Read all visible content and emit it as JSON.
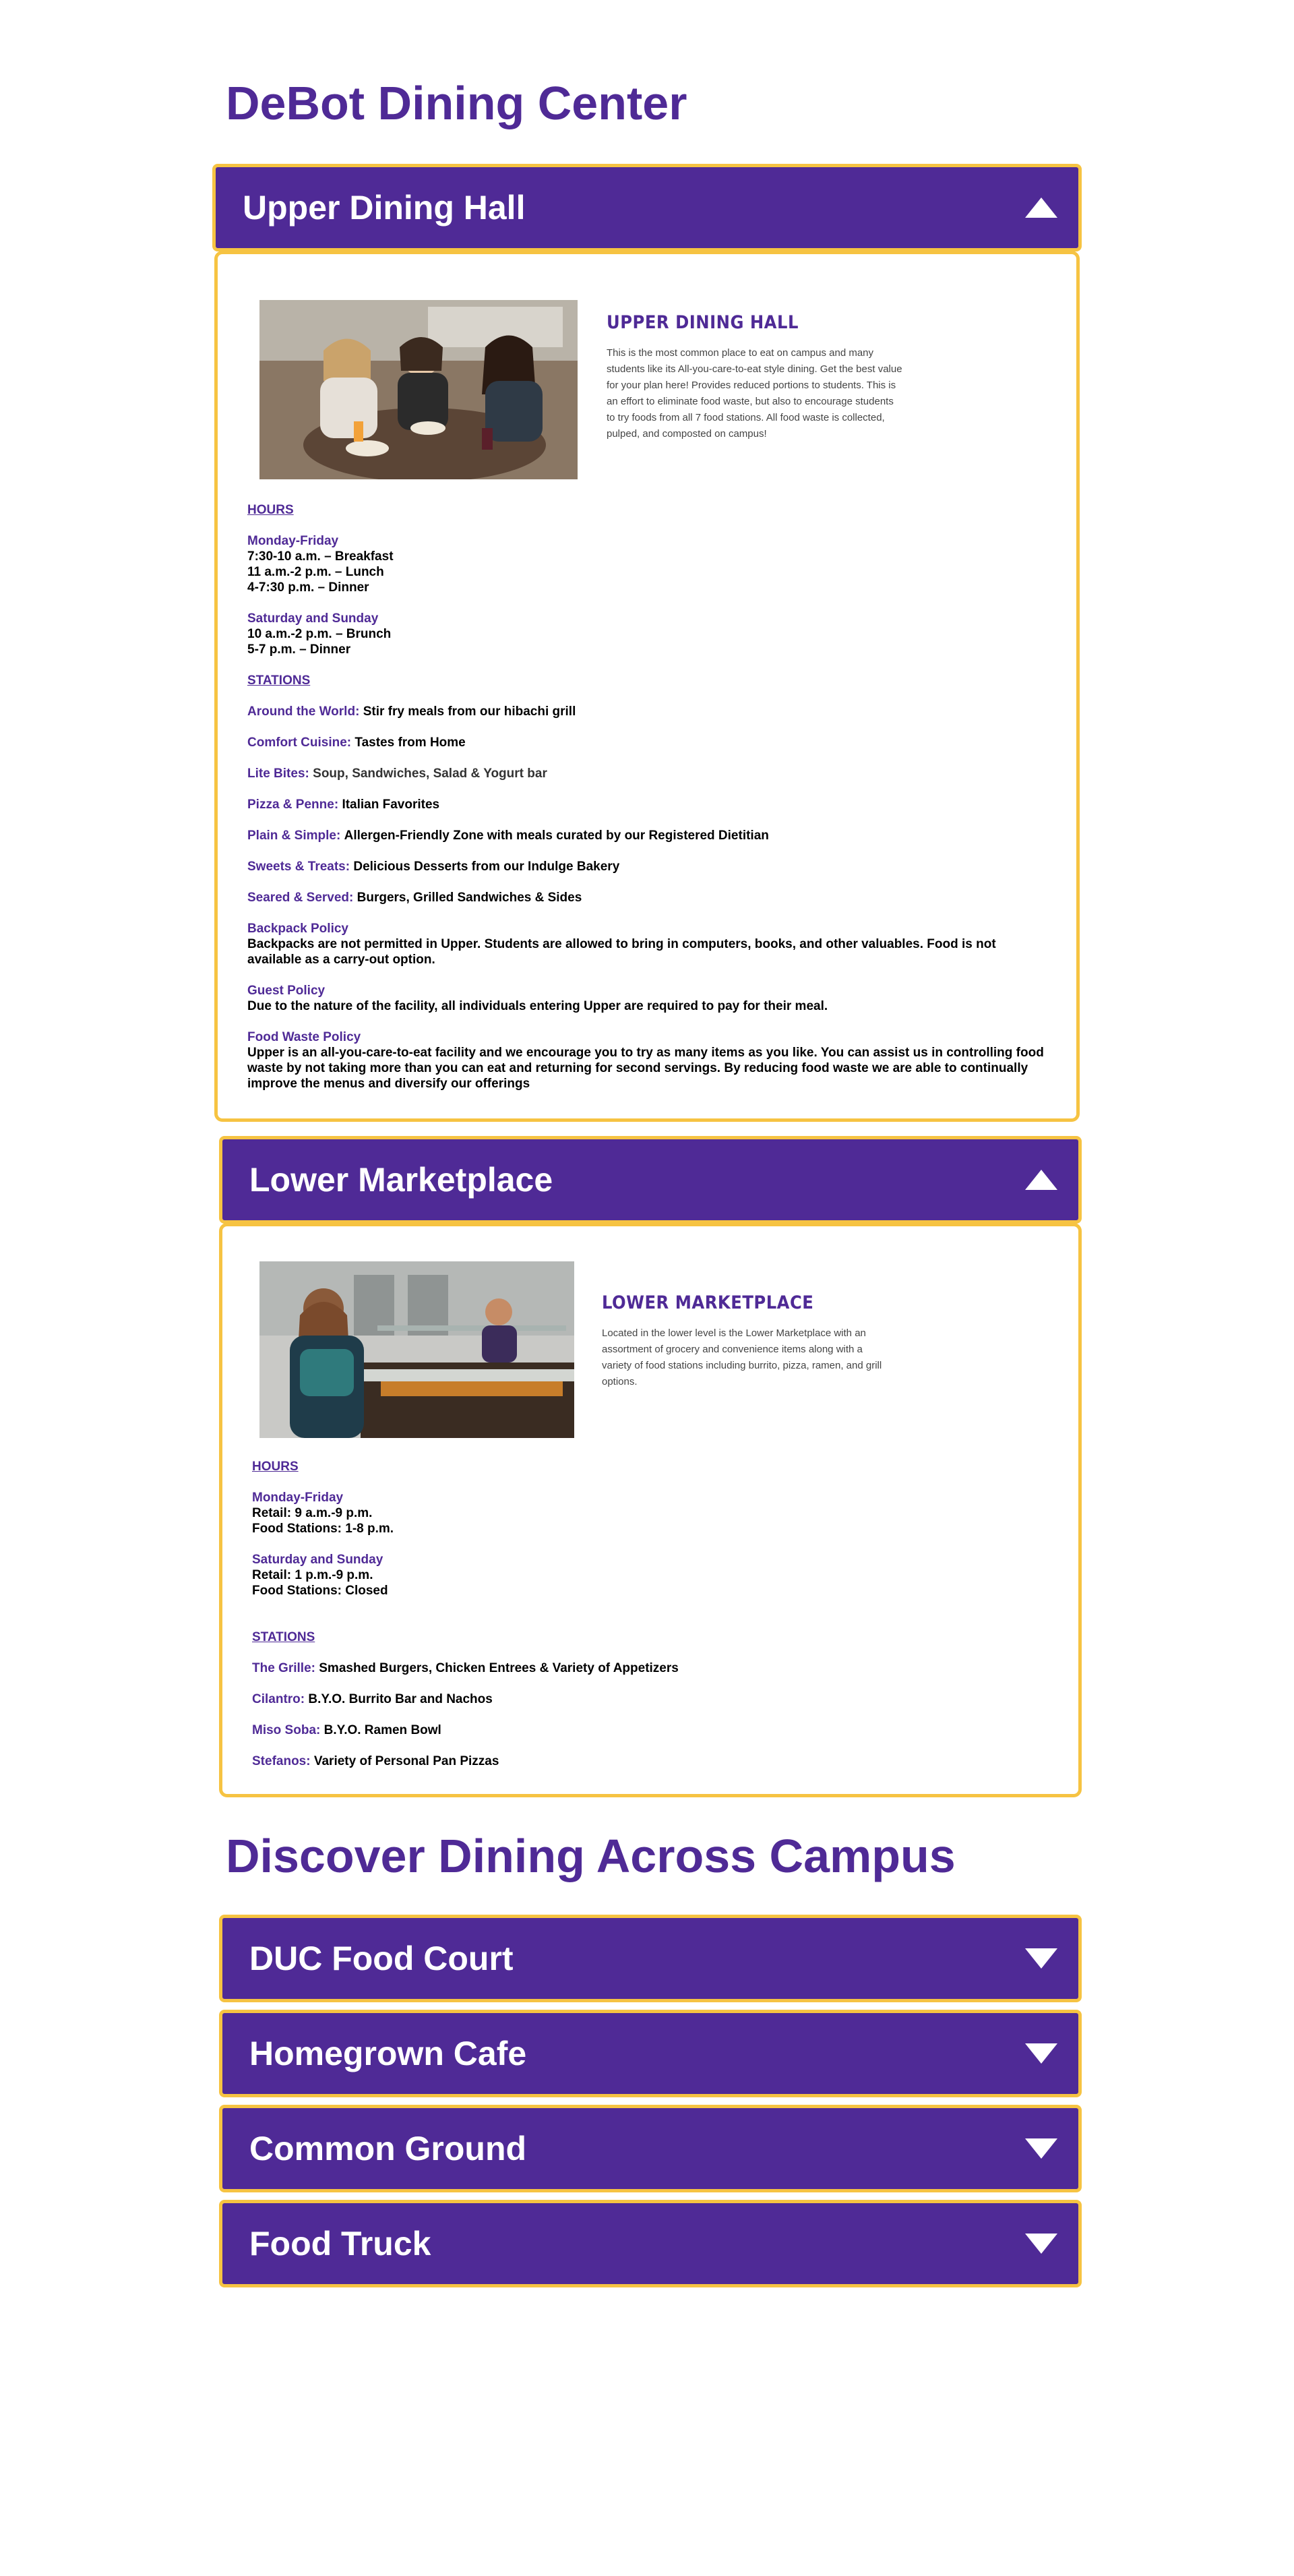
{
  "page_title": "DeBot Dining Center",
  "upper": {
    "header": "Upper Dining Hall",
    "card_title": "UPPER DINING HALL",
    "card_text": "This is the most common place to eat on campus and many students like its All-you-care-to-eat style dining. Get the best value for your plan here! Provides reduced portions to students. This is an effort to eliminate food waste, but also to encourage students to try foods from all 7 food stations. All food waste is collected, pulped, and composted on campus!",
    "hours_heading": "HOURS",
    "weekday_label": "Monday-Friday",
    "weekday_lines": [
      "7:30-10 a.m. – Breakfast",
      "11 a.m.-2 p.m. – Lunch",
      "4-7:30 p.m. – Dinner"
    ],
    "weekend_label": "Saturday and Sunday",
    "weekend_lines": [
      "10 a.m.-2 p.m. – Brunch",
      "5-7 p.m. – Dinner"
    ],
    "stations_heading": "STATIONS",
    "stations": [
      {
        "name": "Around the World:",
        "desc": "Stir fry meals from our hibachi grill"
      },
      {
        "name": "Comfort Cuisine:",
        "desc": "Tastes from Home"
      },
      {
        "name": "Lite Bites:",
        "desc": "Soup, Sandwiches, Salad & Yogurt bar"
      },
      {
        "name": "Pizza & Penne:",
        "desc": "Italian Favorites"
      },
      {
        "name": "Plain & Simple:",
        "desc": "Allergen-Friendly Zone with meals curated by our Registered Dietitian"
      },
      {
        "name": "Sweets & Treats:",
        "desc": "Delicious Desserts from our Indulge Bakery"
      },
      {
        "name": "Seared & Served:",
        "desc": "Burgers, Grilled Sandwiches & Sides"
      }
    ],
    "backpack_title": "Backpack Policy",
    "backpack_text": "Backpacks are not permitted in Upper. Students are allowed to bring in computers, books, and other valuables. Food is not available as a carry-out option.",
    "guest_title": "Guest Policy",
    "guest_text": "Due to the nature of the facility, all individuals entering Upper are required to pay for their meal.",
    "waste_title": "Food Waste Policy",
    "waste_text": "Upper is an all-you-care-to-eat facility and we encourage you to try as many items as you like. You can assist us in controlling food waste by not taking more than you can eat and returning for second servings. By reducing food waste we are able to continually improve the menus and diversify our offerings"
  },
  "lower": {
    "header": "Lower Marketplace",
    "card_title": "LOWER MARKETPLACE",
    "card_text": "Located in the lower level is the Lower Marketplace with an assortment of grocery and convenience items along with a variety of food stations including burrito, pizza, ramen, and grill options.",
    "hours_heading": "HOURS",
    "weekday_label": "Monday-Friday",
    "weekday_lines": [
      "Retail: 9 a.m.-9 p.m.",
      "Food Stations: 1-8 p.m."
    ],
    "weekend_label": "Saturday and Sunday",
    "weekend_lines": [
      "Retail: 1 p.m.-9 p.m.",
      "Food Stations: Closed"
    ],
    "stations_heading": "STATIONS",
    "stations": [
      {
        "name": "The Grille:",
        "desc": "Smashed Burgers, Chicken Entrees & Variety of Appetizers"
      },
      {
        "name": "Cilantro:",
        "desc": "B.Y.O. Burrito Bar and Nachos"
      },
      {
        "name": "Miso Soba:",
        "desc": "B.Y.O. Ramen Bowl"
      },
      {
        "name": "Stefanos:",
        "desc": "Variety of Personal Pan Pizzas"
      }
    ]
  },
  "discover_title": "Discover Dining Across Campus",
  "campus": [
    "DUC Food Court",
    "Homegrown Cafe",
    "Common Ground",
    "Food Truck"
  ],
  "colors": {
    "brand_purple": "#4f2a96",
    "gold_border": "#f6c342"
  }
}
